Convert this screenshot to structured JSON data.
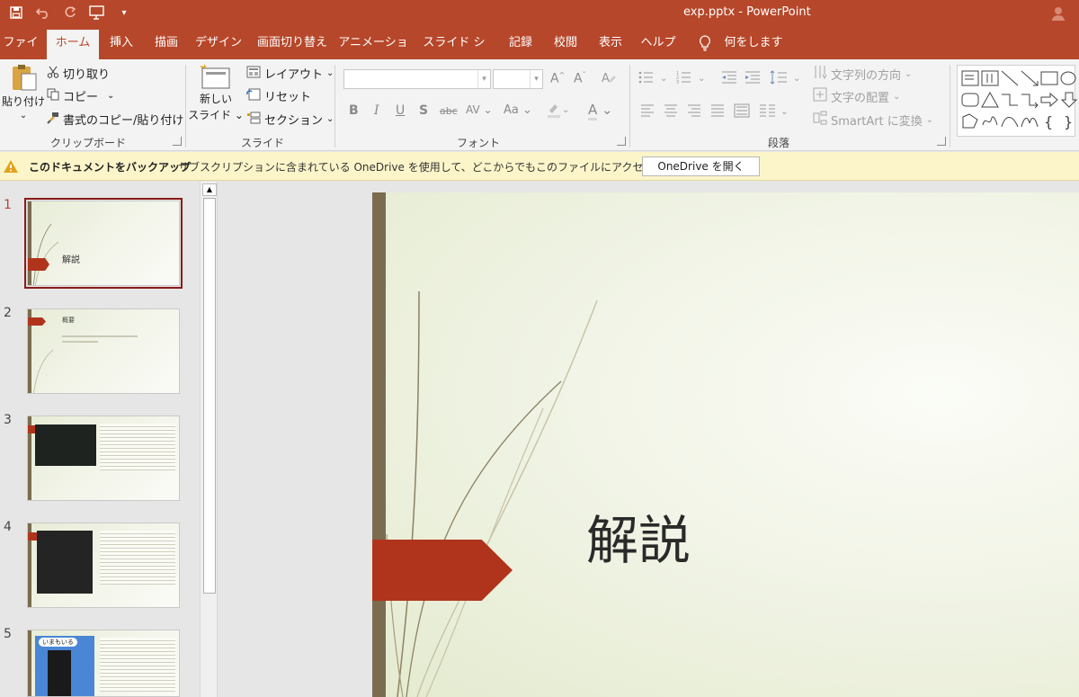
{
  "window": {
    "title": "exp.pptx  -  PowerPoint"
  },
  "tabs": [
    "ファイル",
    "ホーム",
    "挿入",
    "描画",
    "デザイン",
    "画面切り替え",
    "アニメーション",
    "スライド ショー",
    "記録",
    "校閲",
    "表示",
    "ヘルプ"
  ],
  "tell_me": "何をしますか",
  "clipboard": {
    "paste": "貼り付け",
    "cut": "切り取り",
    "copy": "コピー",
    "format_painter": "書式のコピー/貼り付け",
    "label": "クリップボード"
  },
  "slides_group": {
    "new_slide_line1": "新しい",
    "new_slide_line2": "スライド",
    "layout": "レイアウト",
    "reset": "リセット",
    "section": "セクション",
    "label": "スライド"
  },
  "font_group": {
    "label": "フォント",
    "bold": "B",
    "italic": "I",
    "underline": "U",
    "shadow": "S",
    "strike": "abc",
    "spacing": "AV",
    "case": "Aa",
    "color": "A"
  },
  "paragraph_group": {
    "label": "段落",
    "text_direction": "文字列の方向",
    "align_text": "文字の配置",
    "smartart": "SmartArt に変換"
  },
  "message_bar": {
    "title": "このドキュメントをバックアップ",
    "text": "サブスクリプションに含まれている OneDrive を使用して、どこからでもこのファイルにアクセスできます。",
    "button": "OneDrive を開く"
  },
  "thumbnails": [
    {
      "number": "1",
      "title": "解説"
    },
    {
      "number": "2",
      "title": "概要"
    },
    {
      "number": "3"
    },
    {
      "number": "4"
    },
    {
      "number": "5",
      "title": "いまもいる"
    }
  ],
  "slide": {
    "title": "解説"
  },
  "colors": {
    "accent": "#b7472a",
    "slide_tag": "#b0341c",
    "slide_bar": "#7b6c50"
  }
}
